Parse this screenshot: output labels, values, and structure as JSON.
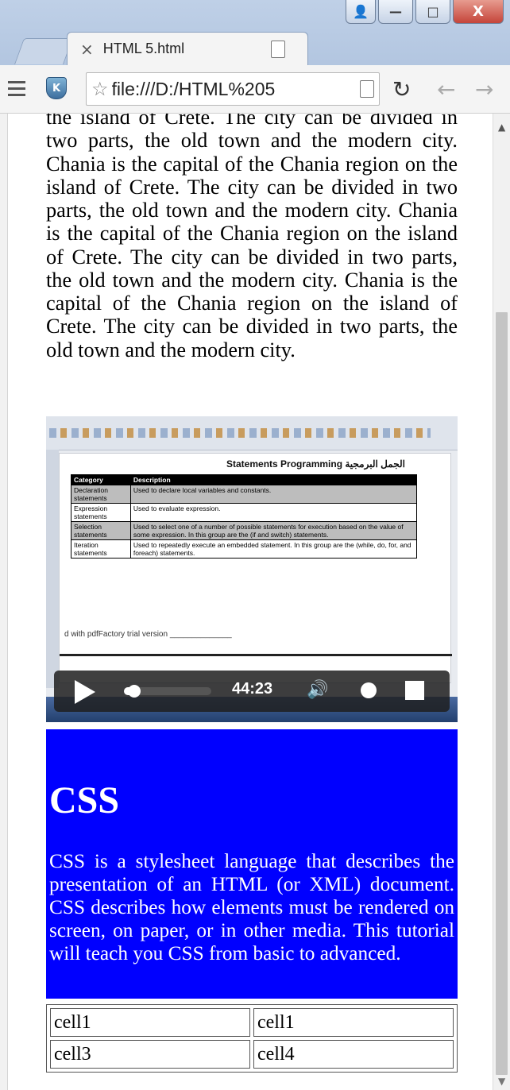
{
  "window": {
    "minimize_glyph": "—",
    "maximize_glyph": "□",
    "close_glyph": "X"
  },
  "tab": {
    "title": "HTML 5.html",
    "close_glyph": "×"
  },
  "toolbar": {
    "url": "file:///D:/HTML%205"
  },
  "paragraph": "the island of Crete. The city can be divided in two parts, the old town and the modern city. Chania is the capital of the Chania region on the island of Crete. The city can be divided in two parts, the old town and the modern city. Chania is the capital of the Chania region on the island of Crete. The city can be divided in two parts, the old town and the modern city. Chania is the capital of the Chania region on the island of Crete. The city can be divided in two parts, the old town and the modern city.",
  "video": {
    "time": "44:23",
    "progress": 0.12,
    "frame": {
      "title": "Statements Programming  الجمل البرمجية",
      "headers": [
        "Category",
        "Description"
      ],
      "rows": [
        [
          "Declaration statements",
          "Used to declare local variables and constants."
        ],
        [
          "Expression statements",
          "Used to evaluate expression."
        ],
        [
          "Selection statements",
          "Used to select one of a number of possible statements for execution based on the value of some expression. In this group are the (if and switch) statements."
        ],
        [
          "Iteration statements",
          "Used to repeatedly execute an embedded statement. In this group are the (while, do, for, and foreach) statements."
        ]
      ],
      "footer": "d with pdfFactory trial version ______________"
    }
  },
  "css_section": {
    "heading": "CSS",
    "body": "CSS is a stylesheet language that describes the presentation of an HTML (or XML) document. CSS describes how elements must be rendered on screen, on paper, or in other media. This tutorial will teach you CSS from basic to advanced."
  },
  "table": {
    "rows": [
      [
        "cell1",
        "cell1"
      ],
      [
        "cell3",
        "cell4"
      ]
    ]
  }
}
